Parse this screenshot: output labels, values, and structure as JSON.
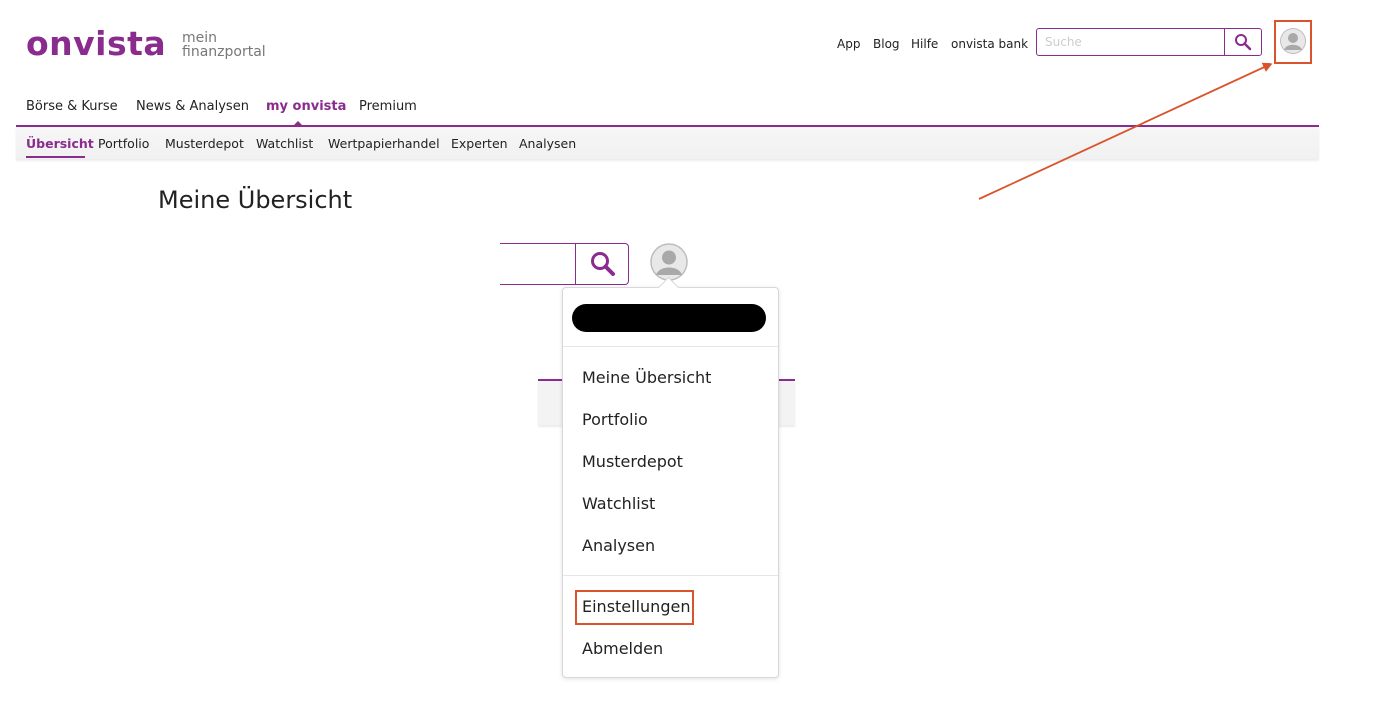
{
  "brand": {
    "logo": "onvista",
    "tagline_line1": "mein",
    "tagline_line2": "finanzportal",
    "color": "#8a2b8e"
  },
  "top_links": [
    "App",
    "Blog",
    "Hilfe",
    "onvista bank"
  ],
  "search": {
    "placeholder": "Suche",
    "icon": "search-icon"
  },
  "main_nav": [
    {
      "label": "Börse & Kurse",
      "active": false
    },
    {
      "label": "News & Analysen",
      "active": false
    },
    {
      "label": "my onvista",
      "active": true
    },
    {
      "label": "Premium",
      "active": false
    }
  ],
  "sub_nav": [
    {
      "label": "Übersicht",
      "active": true
    },
    {
      "label": "Portfolio",
      "active": false
    },
    {
      "label": "Musterdepot",
      "active": false
    },
    {
      "label": "Watchlist",
      "active": false
    },
    {
      "label": "Wertpapierhandel",
      "active": false
    },
    {
      "label": "Experten",
      "active": false
    },
    {
      "label": "Analysen",
      "active": false
    }
  ],
  "page_title": "Meine Übersicht",
  "user_menu": {
    "items": [
      "Meine Übersicht",
      "Portfolio",
      "Musterdepot",
      "Watchlist",
      "Analysen"
    ],
    "settings": "Einstellungen",
    "logout": "Abmelden"
  },
  "annotation_color": "#d9532b"
}
